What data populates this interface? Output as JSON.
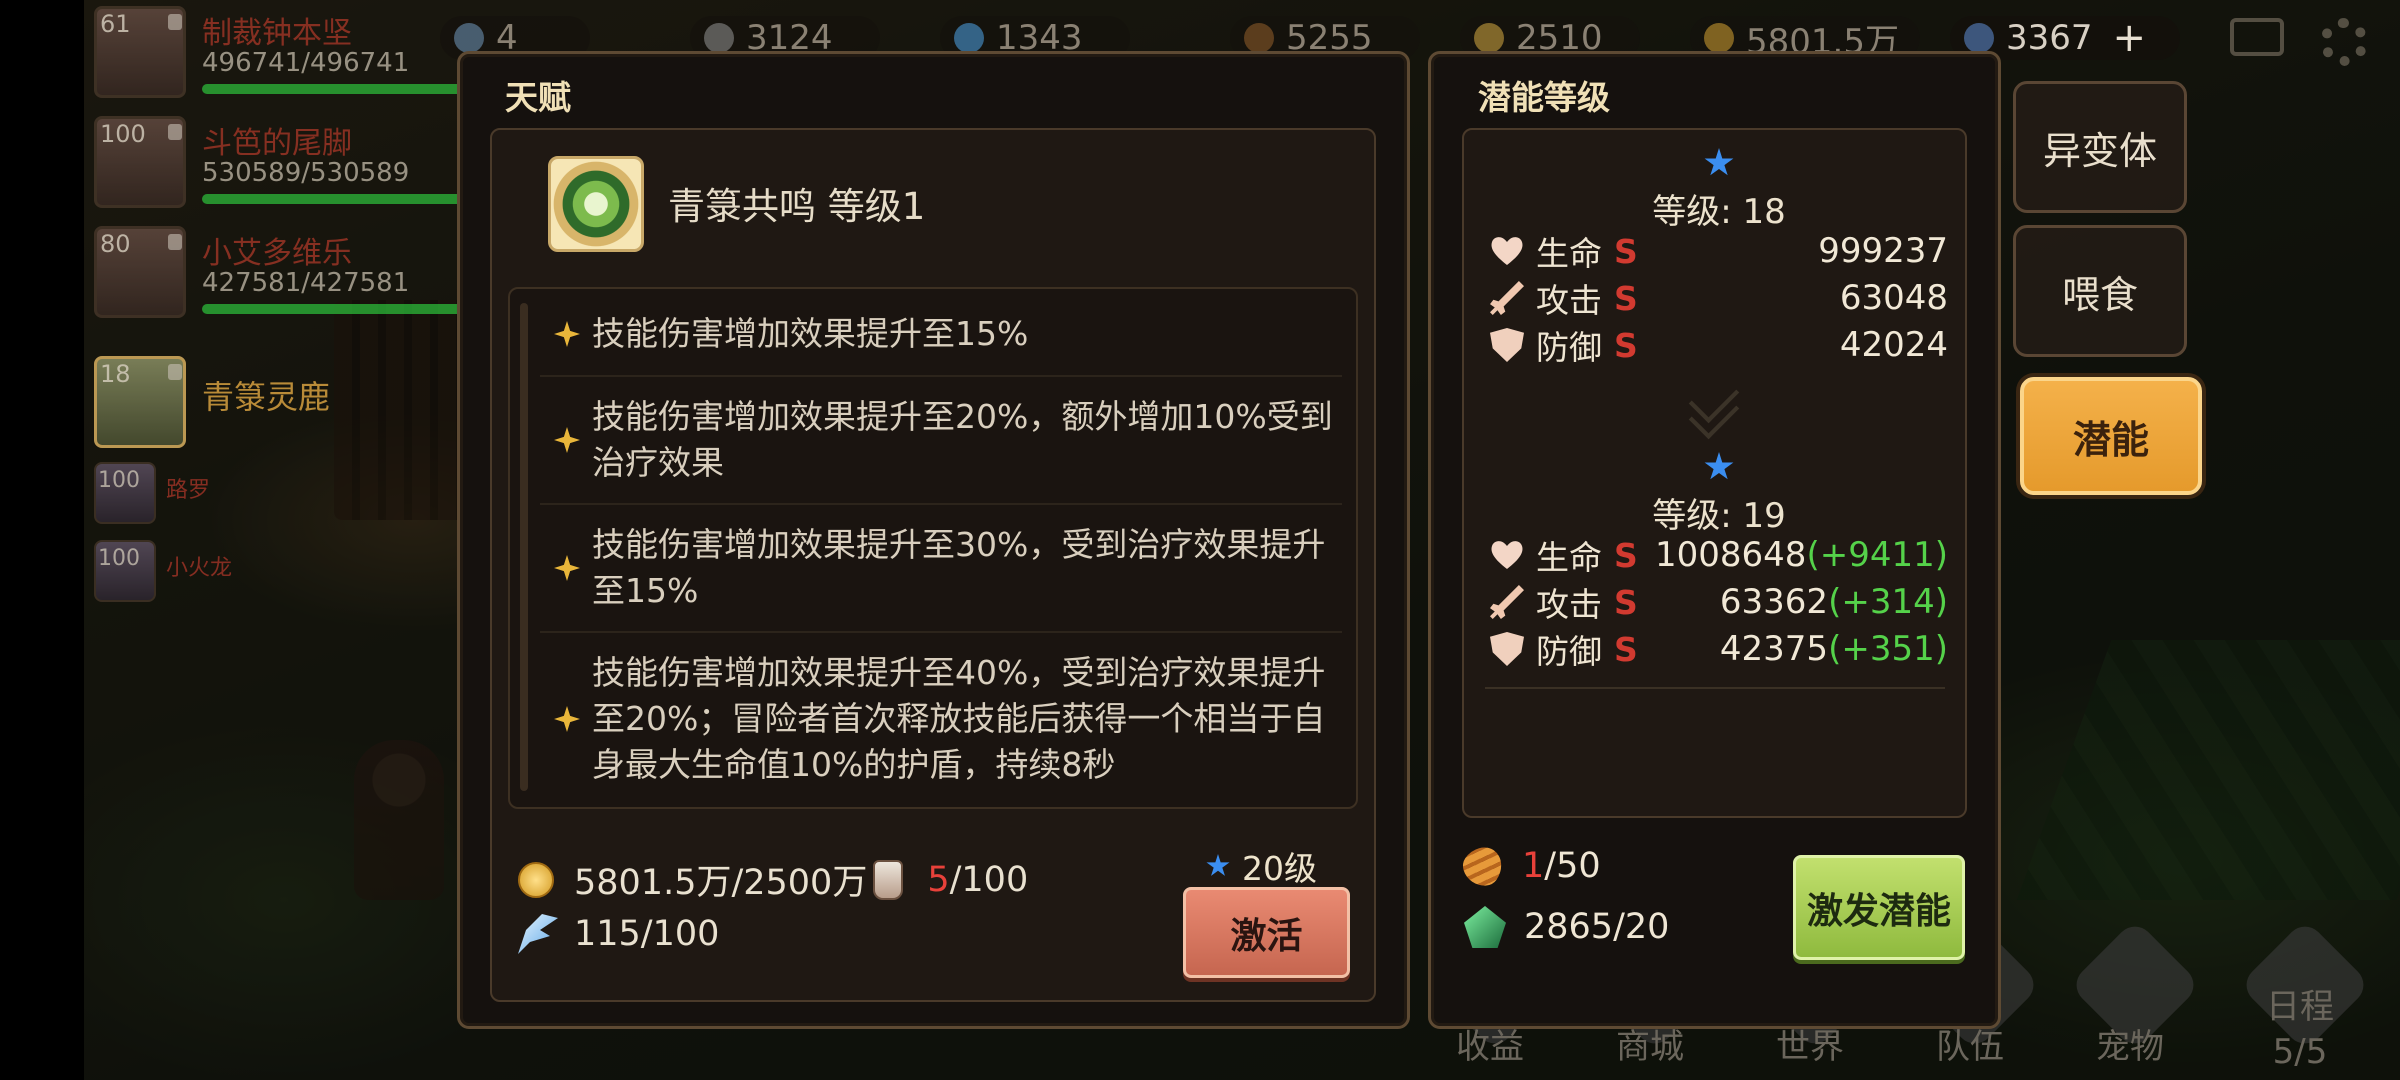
{
  "top_bar": {
    "resources": [
      {
        "icon": "flask-icon",
        "value": "4"
      },
      {
        "icon": "ore-icon",
        "value": "3124"
      },
      {
        "icon": "crystal-icon",
        "value": "1343"
      },
      {
        "icon": "wood-icon",
        "value": "5255"
      },
      {
        "icon": "wheat-icon",
        "value": "2510"
      },
      {
        "icon": "gold-coin-icon",
        "value": "5801.5万"
      },
      {
        "icon": "diamond-icon",
        "value": "3367"
      }
    ],
    "add_icon": "plus-icon",
    "mail_icon": "mail-icon",
    "settings_icon": "gear-icon"
  },
  "party": [
    {
      "level": "61",
      "name": "制裁钟本坚",
      "hp": "496741/496741",
      "hp_fraction": 1.0
    },
    {
      "level": "100",
      "name": "斗笆的尾脚",
      "hp": "530589/530589",
      "hp_fraction": 1.0
    },
    {
      "level": "80",
      "name": "小艾多维乐",
      "hp": "427581/427581",
      "hp_fraction": 1.0
    }
  ],
  "selected_pet": {
    "level": "18",
    "name": "青箓灵鹿"
  },
  "small_pets": [
    {
      "level": "100",
      "name": "路罗"
    },
    {
      "level": "100",
      "name": "小火龙"
    }
  ],
  "talent_panel": {
    "title": "天赋",
    "skill_name": "青箓共鸣 等级1",
    "descriptions": [
      "技能伤害增加效果提升至15%",
      "技能伤害增加效果提升至20%，额外增加10%受到治疗效果",
      "技能伤害增加效果提升至30%，受到治疗效果提升至15%",
      "技能伤害增加效果提升至40%，受到治疗效果提升至20%；冒险者首次释放技能后获得一个相当于自身最大生命值10%的护盾，持续8秒"
    ],
    "cost_gold": "5801.5万/2500万",
    "cost_potion_have": "5",
    "cost_potion_need": "/100",
    "cost_wing": "115/100",
    "required_level": "20级",
    "activate_label": "激活"
  },
  "potential_panel": {
    "title": "潜能等级",
    "current": {
      "level_text": "等级: 18",
      "stats": [
        {
          "icon": "heart-icon",
          "label": "生命",
          "grade": "S",
          "value": "999237",
          "plus": ""
        },
        {
          "icon": "sword-icon",
          "label": "攻击",
          "grade": "S",
          "value": "63048",
          "plus": ""
        },
        {
          "icon": "shield-icon",
          "label": "防御",
          "grade": "S",
          "value": "42024",
          "plus": ""
        }
      ]
    },
    "next": {
      "level_text": "等级: 19",
      "stats": [
        {
          "icon": "heart-icon",
          "label": "生命",
          "grade": "S",
          "value": "1008648",
          "plus": "(+9411)"
        },
        {
          "icon": "sword-icon",
          "label": "攻击",
          "grade": "S",
          "value": "63362",
          "plus": "(+314)"
        },
        {
          "icon": "shield-icon",
          "label": "防御",
          "grade": "S",
          "value": "42375",
          "plus": "(+351)"
        }
      ]
    },
    "cost_seed_have": "1",
    "cost_seed_need": "/50",
    "cost_gem": "2865/20",
    "awaken_label": "激发潜能"
  },
  "side_tabs": [
    {
      "label": "异变体",
      "active": false
    },
    {
      "label": "喂食",
      "active": false
    },
    {
      "label": "潜能",
      "active": true
    }
  ],
  "bottom_nav": [
    {
      "label": "收益"
    },
    {
      "label": "商城"
    },
    {
      "label": "世界"
    },
    {
      "label": "队伍"
    },
    {
      "label": "宠物"
    },
    {
      "label": "日程"
    }
  ],
  "schedule_count": "5/5",
  "colors": {
    "panel_border": "#5e4a33",
    "grade_red": "#d23a30",
    "gain_green": "#55d24a",
    "activate_button": "#d9775f",
    "awaken_button": "#a9cd55",
    "active_tab": "#eda43a",
    "level_star": "#3b8ef0"
  }
}
